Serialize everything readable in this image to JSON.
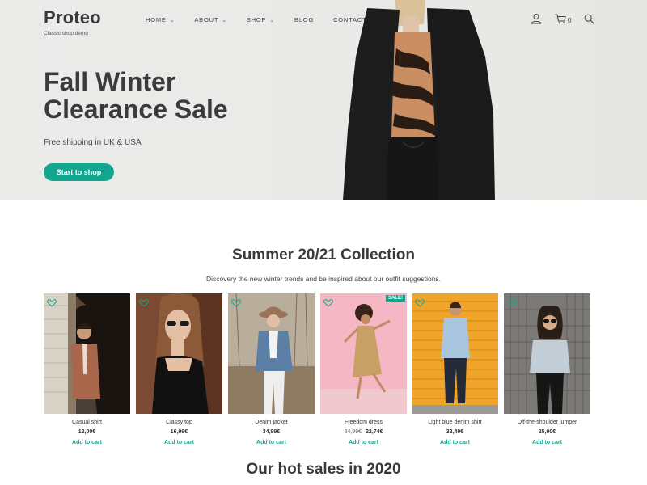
{
  "brand": {
    "name": "Proteo",
    "tagline": "Classic shop demo"
  },
  "nav": [
    {
      "label": "HOME",
      "dropdown": true
    },
    {
      "label": "ABOUT",
      "dropdown": true
    },
    {
      "label": "SHOP",
      "dropdown": true
    },
    {
      "label": "BLOG",
      "dropdown": false
    },
    {
      "label": "CONTACT",
      "dropdown": false
    }
  ],
  "header_icons": {
    "account": "user-icon",
    "cart": "cart-icon",
    "cart_count": "0",
    "search": "search-icon"
  },
  "hero": {
    "title": "Fall Winter Clearance Sale",
    "subtitle": "Free shipping in UK & USA",
    "button": "Start to shop"
  },
  "collection": {
    "title": "Summer 20/21 Collection",
    "subtitle": "Discovery the new winter trends and be inspired about our outfit suggestions.",
    "products": [
      {
        "name": "Casual shirt",
        "price": "12,00€",
        "old_price": "",
        "sale": "",
        "add": "Add to cart"
      },
      {
        "name": "Classy top",
        "price": "16,99€",
        "old_price": "",
        "sale": "",
        "add": "Add to cart"
      },
      {
        "name": "Denim jacket",
        "price": "34,99€",
        "old_price": "",
        "sale": "",
        "add": "Add to cart"
      },
      {
        "name": "Freedom dress",
        "price": "22,74€",
        "old_price": "34,99€",
        "sale": "SALE!",
        "add": "Add to cart"
      },
      {
        "name": "Light blue denim shirt",
        "price": "32,49€",
        "old_price": "",
        "sale": "",
        "add": "Add to cart"
      },
      {
        "name": "Off-the-shoulder jumper",
        "price": "25,00€",
        "old_price": "",
        "sale": "",
        "add": "Add to cart"
      }
    ]
  },
  "hot_sales": {
    "title": "Our hot sales in 2020"
  },
  "colors": {
    "accent": "#12a68e",
    "text": "#3a3a3a",
    "hero_bg": "#e9e9e7"
  }
}
